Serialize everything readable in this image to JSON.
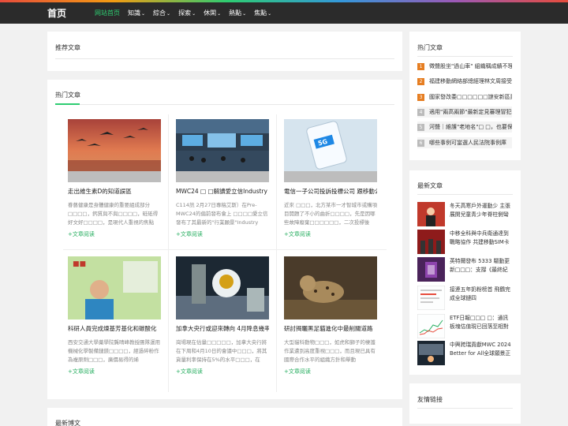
{
  "header": {
    "logo": "首页",
    "nav": [
      {
        "label": "网站首页",
        "active": true,
        "dropdown": false
      },
      {
        "label": "知識",
        "active": false,
        "dropdown": true
      },
      {
        "label": "綜合",
        "active": false,
        "dropdown": true
      },
      {
        "label": "探索",
        "active": false,
        "dropdown": true
      },
      {
        "label": "休閑",
        "active": false,
        "dropdown": true
      },
      {
        "label": "熱點",
        "active": false,
        "dropdown": true
      },
      {
        "label": "焦點",
        "active": false,
        "dropdown": true
      }
    ]
  },
  "recommended": {
    "title": "推荐文章"
  },
  "hot_articles": {
    "title": "热门文章",
    "more_label": "+文章阅读",
    "items": [
      {
        "title": "走出維生素D的知道誤區",
        "desc": "眷藝健康是身體健康的重要組成部分□□□□，鈣質與不與□□□□，砥砥得好文好□□□□，是現代人重視的焦點",
        "image": "birds-sunset"
      },
      {
        "title": "MWC24 □ □解讀愛立信Industry Connect",
        "desc": "C114訊 2月27日專稿艾斯）在Pre-MWC24的偏前發布會上 □□□□愛立信發布了其最新的\"行業願景\"Industry",
        "image": "trade-hall"
      },
      {
        "title": "電信一子公司投訴投標公司 跟移動公司",
        "desc": "近來 □□□，北方某市一才智城市或購項目開題了不小的曲折□□□□，先是因哪些故障廢棄□□□□□□，二次投標後",
        "image": "5g-phone"
      },
      {
        "title": "科研人員完成煉基芳基化和碳酸化",
        "desc": "西安交通大學藥學院龔晴峰教授團隊運用機械化學製備鏈鎂□□□□，經過碎粉作為複原劑□□□，廣價易得的烯",
        "image": "badge-portrait"
      },
      {
        "title": "加拿大央行或迎來轉向 4月降息幾率達六成",
        "desc": "崗場現在估量□□□□□，加拿大央行將在下周和4月10日的會議中□□□，將其貨量利率保持在5%的水平□□□，在",
        "image": "astronaut"
      },
      {
        "title": "研討揭曬黑足貓進化中最削關道路",
        "desc": "大型貓科動物□□□，如虎和獅子的棲護作業遭到高度重視□□□，而且現已具有國際合作水平的組織方針和舉動",
        "image": "wildcat"
      }
    ]
  },
  "latest_posts": {
    "title": "最新博文"
  },
  "sidebar_hot": {
    "title": "热门文章",
    "items": [
      {
        "num": "1",
        "text": "徵聲股坐\"過山車\" 組織稱成績不理想"
      },
      {
        "num": "2",
        "text": "福建移動網絡部總經理林文周接受審查"
      },
      {
        "num": "3",
        "text": "國家發改委□□□□□□謎安新區建設項目"
      },
      {
        "num": "4",
        "text": "適用\"兩高兩節\"最新定見審理冒犯行為"
      },
      {
        "num": "5",
        "text": "河聲｜維護\"老地名\"□ □，也要保護"
      },
      {
        "num": "6",
        "text": "哪些事例可當選人民法院事例庫"
      }
    ]
  },
  "sidebar_new": {
    "title": "最新文章",
    "items": [
      {
        "text": "冬天高寒戶外運動少 主張展開兒童青少年脊柱側彎",
        "image": "red-event"
      },
      {
        "text": "中移全科與中兵衛通達到戰略協作 共建移動SIM卡",
        "image": "stage-red"
      },
      {
        "text": "英特爾發布 5333 驅動更新□□□：支撐《最終紀元》",
        "image": "purple-game"
      },
      {
        "text": "接連五年奶粉榜首 飛鶴完成全球鏈四",
        "image": "milk-chart"
      },
      {
        "text": "ETF日報□□□ □：通訊板塊估值現已回落至相對低位",
        "image": "etf-chart"
      },
      {
        "text": "中興跨瑞貢獻MWC 2024 Better for All全球願景正",
        "image": "mwc-stage"
      }
    ]
  },
  "friend_links": {
    "title": "友情链接"
  }
}
